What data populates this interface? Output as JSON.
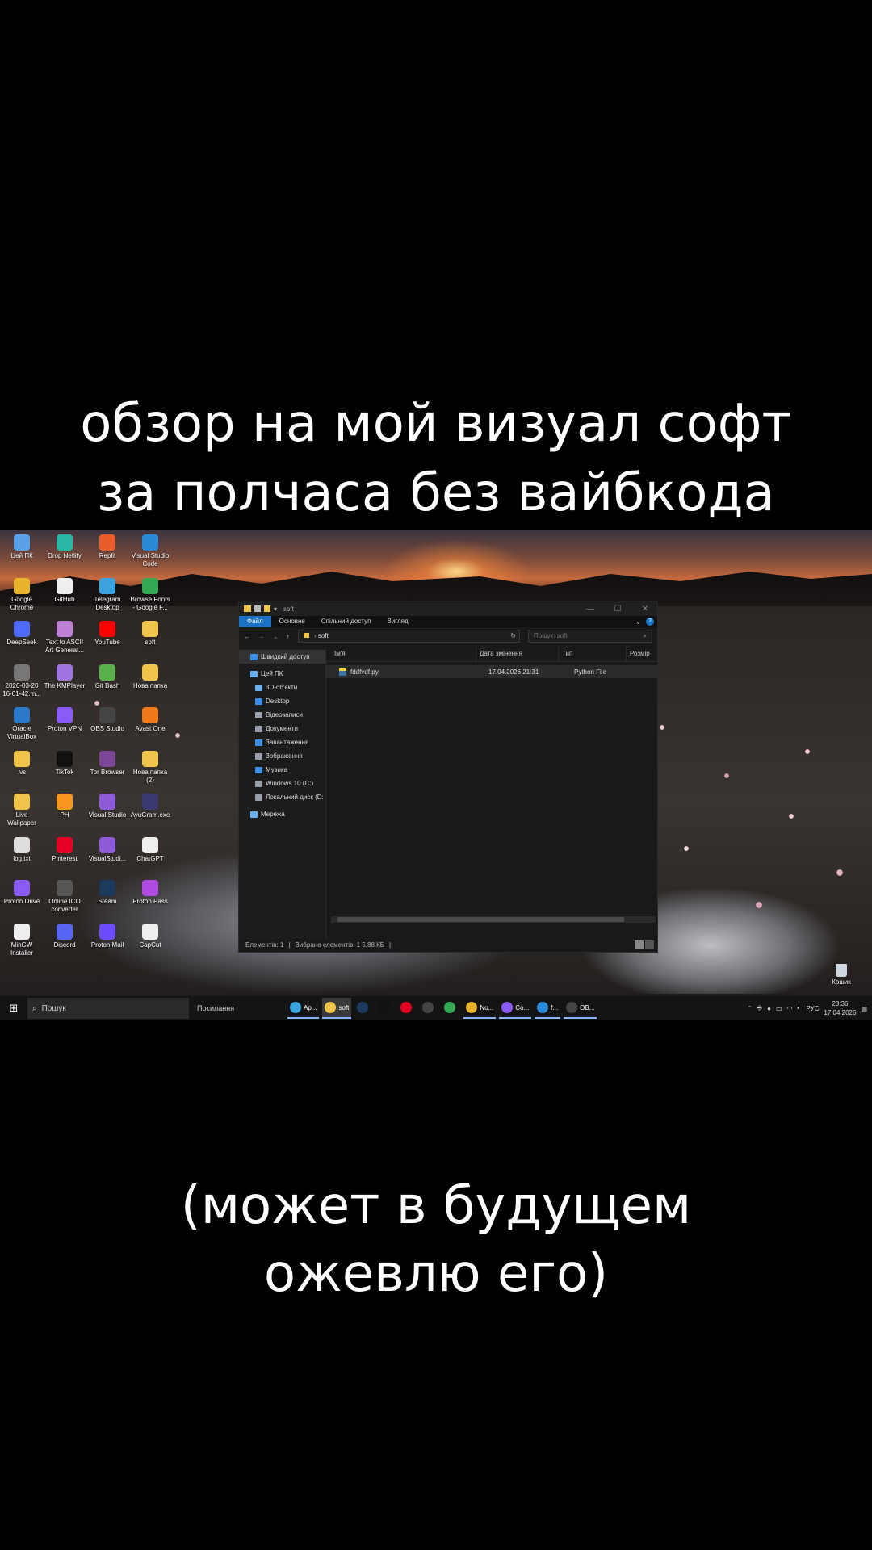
{
  "captions": {
    "top_line1": "обзор на мой визуал софт",
    "top_line2": "за полчаса без вайбкода",
    "bottom_line1": "(может в будущем",
    "bottom_line2": "ожевлю его)"
  },
  "desktop_icons": [
    {
      "label": "Цей ПК",
      "color": "#5aa0e6"
    },
    {
      "label": "Drop Netlify",
      "color": "#2bb7a5"
    },
    {
      "label": "Replit",
      "color": "#e85d2a"
    },
    {
      "label": "Visual Studio Code",
      "color": "#2a8ad8"
    },
    {
      "label": "Google Chrome",
      "color": "#e8b32a"
    },
    {
      "label": "GitHub",
      "color": "#eeeeee"
    },
    {
      "label": "Telegram Desktop",
      "color": "#3aa3e0"
    },
    {
      "label": "Browse Fonts - Google F...",
      "color": "#34a853"
    },
    {
      "label": "DeepSeek",
      "color": "#4d6bfe"
    },
    {
      "label": "Text to ASCII Art Generat...",
      "color": "#c07fd6"
    },
    {
      "label": "YouTube",
      "color": "#ff0000"
    },
    {
      "label": "soft",
      "color": "#f0c44a"
    },
    {
      "label": "2026-03-20 16-01-42.m...",
      "color": "#777777"
    },
    {
      "label": "The KMPlayer",
      "color": "#a074e0"
    },
    {
      "label": "Git Bash",
      "color": "#5ab04a"
    },
    {
      "label": "Нова папка",
      "color": "#f0c44a"
    },
    {
      "label": "Oracle VirtualBox",
      "color": "#2a78c8"
    },
    {
      "label": "Proton VPN",
      "color": "#8a5cf5"
    },
    {
      "label": "OBS Studio",
      "color": "#444444"
    },
    {
      "label": "Avast One",
      "color": "#f07a1a"
    },
    {
      "label": ".vs",
      "color": "#f0c44a"
    },
    {
      "label": "TikTok",
      "color": "#111111"
    },
    {
      "label": "Tor Browser",
      "color": "#7d4698"
    },
    {
      "label": "Нова папка (2)",
      "color": "#f0c44a"
    },
    {
      "label": "Live Wallpaper",
      "color": "#f0c44a"
    },
    {
      "label": "PH",
      "color": "#f7971d"
    },
    {
      "label": "Visual Studio",
      "color": "#8f5ad8"
    },
    {
      "label": "AyuGram.exe",
      "color": "#3a3a70"
    },
    {
      "label": "log.txt",
      "color": "#dddddd"
    },
    {
      "label": "Pinterest",
      "color": "#e60023"
    },
    {
      "label": "VisualStudi...",
      "color": "#8f5ad8"
    },
    {
      "label": "ChatGPT",
      "color": "#eeeeee"
    },
    {
      "label": "Proton Drive",
      "color": "#8a5cf5"
    },
    {
      "label": "Online ICO converter",
      "color": "#555555"
    },
    {
      "label": "Steam",
      "color": "#1b3a5c"
    },
    {
      "label": "Proton Pass",
      "color": "#b04ae0"
    },
    {
      "label": "MinGW Installer",
      "color": "#eeeeee"
    },
    {
      "label": "Discord",
      "color": "#5865f2"
    },
    {
      "label": "Proton Mail",
      "color": "#6d4aff"
    },
    {
      "label": "CapCut",
      "color": "#eeeeee"
    }
  ],
  "recycle_bin": {
    "label": "Кошик"
  },
  "explorer": {
    "title": "soft",
    "ribbon_tabs": [
      "Файл",
      "Основне",
      "Спільний доступ",
      "Вигляд"
    ],
    "address": "soft",
    "search_placeholder": "Пошук: soft",
    "nav_items": [
      {
        "label": "Швидкий доступ",
        "color": "#3a8ee6"
      },
      {
        "label": "Цей ПК",
        "color": "#6ab0f0"
      },
      {
        "label": "3D-об'єкти",
        "color": "#6ab0f0"
      },
      {
        "label": "Desktop",
        "color": "#3a8ee6"
      },
      {
        "label": "Відеозаписи",
        "color": "#9aa0aa"
      },
      {
        "label": "Документи",
        "color": "#9aa0aa"
      },
      {
        "label": "Завантаження",
        "color": "#3a8ee6"
      },
      {
        "label": "Зображення",
        "color": "#9aa0aa"
      },
      {
        "label": "Музика",
        "color": "#3a8ee6"
      },
      {
        "label": "Windows 10 (C:)",
        "color": "#9aa0aa"
      },
      {
        "label": "Локальний диск (D:",
        "color": "#9aa0aa"
      },
      {
        "label": "Мережа",
        "color": "#6ab0f0"
      }
    ],
    "columns": {
      "name": "Ім'я",
      "date": "Дата змінення",
      "type": "Тип",
      "size": "Розмір"
    },
    "files": [
      {
        "name": "fddfvdf.py",
        "date": "17.04.2026 21:31",
        "type": "Python File"
      }
    ],
    "status": {
      "items": "Елементів: 1",
      "selected": "Вибрано елементів: 1 5,88 КБ"
    }
  },
  "taskbar": {
    "search_placeholder": "Пошук",
    "links_label": "Посилання",
    "apps": [
      {
        "label": "Ар...",
        "color": "#3aa3e0",
        "state": "open"
      },
      {
        "label": "soft",
        "color": "#f0c44a",
        "state": "active"
      },
      {
        "label": "",
        "color": "#1b3a5c",
        "state": ""
      },
      {
        "label": "",
        "color": "#111111",
        "state": ""
      },
      {
        "label": "",
        "color": "#e60023",
        "state": ""
      },
      {
        "label": "",
        "color": "#444444",
        "state": ""
      },
      {
        "label": "",
        "color": "#34a853",
        "state": ""
      },
      {
        "label": "No...",
        "color": "#e8b32a",
        "state": "open"
      },
      {
        "label": "Co...",
        "color": "#8a5cf5",
        "state": "open"
      },
      {
        "label": "f...",
        "color": "#2a8ad8",
        "state": "open"
      },
      {
        "label": "OB...",
        "color": "#444444",
        "state": "open"
      }
    ],
    "language": "РУС",
    "time": "23:36",
    "date": "17.04.2026"
  }
}
